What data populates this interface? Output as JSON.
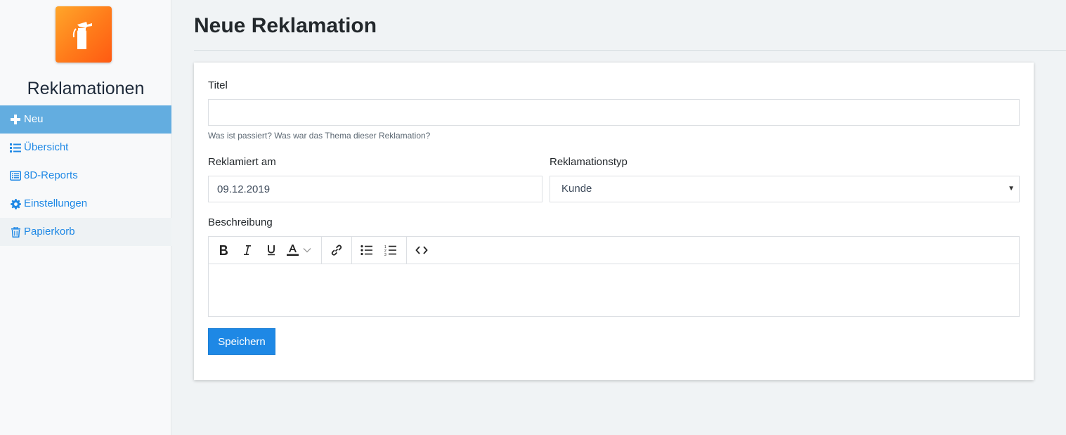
{
  "app": {
    "title": "Reklamationen",
    "logo_icon": "fire-extinguisher-icon",
    "accent_color": "#1e88e5",
    "logo_color": "#ff7a1a"
  },
  "sidebar": {
    "items": [
      {
        "label": "Neu",
        "icon": "plus-icon",
        "active": true
      },
      {
        "label": "Übersicht",
        "icon": "list-icon"
      },
      {
        "label": "8D-Reports",
        "icon": "list-alt-icon"
      },
      {
        "label": "Einstellungen",
        "icon": "gear-icon"
      },
      {
        "label": "Papierkorb",
        "icon": "trash-icon"
      }
    ]
  },
  "page": {
    "title": "Neue Reklamation"
  },
  "form": {
    "title_label": "Titel",
    "title_value": "",
    "title_help": "Was ist passiert? Was war das Thema dieser Reklamation?",
    "date_label": "Reklamiert am",
    "date_value": "09.12.2019",
    "type_label": "Reklamationstyp",
    "type_value": "Kunde",
    "description_label": "Beschreibung",
    "toolbar": [
      "bold-icon",
      "italic-icon",
      "underline-icon",
      "font-color-icon",
      "link-icon",
      "bullet-list-icon",
      "numbered-list-icon",
      "code-view-icon"
    ],
    "save_label": "Speichern"
  }
}
